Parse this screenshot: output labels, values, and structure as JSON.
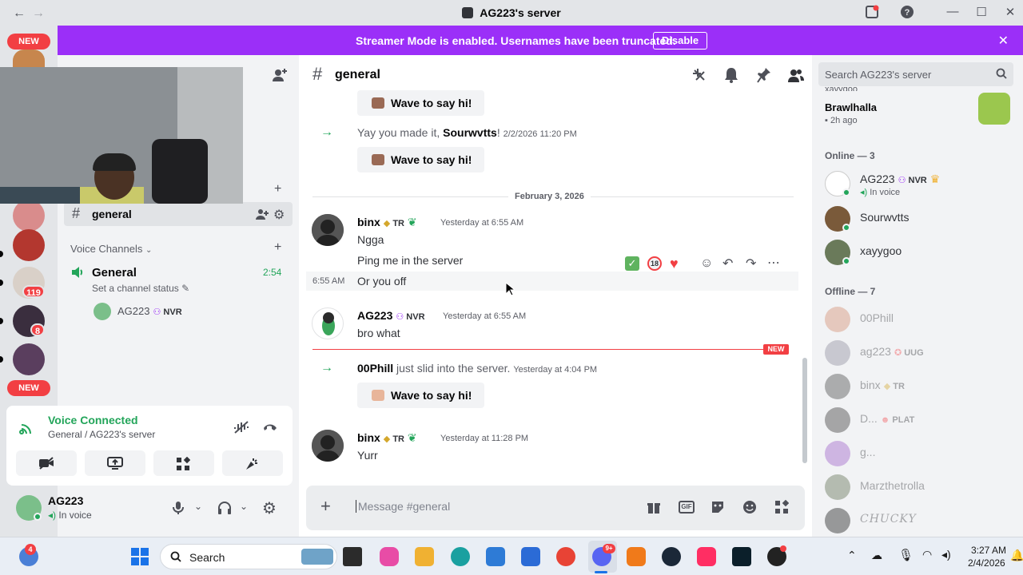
{
  "window": {
    "title": "AG223's server",
    "back": "←",
    "forward": "→"
  },
  "banner": {
    "message": "Streamer Mode is enabled. Usernames have been truncated.",
    "button": "Disable"
  },
  "servers": {
    "new_badge": "NEW",
    "badges": [
      "119",
      "8"
    ]
  },
  "sidebar": {
    "text_channel": "general",
    "voice_header": "Voice Channels",
    "voice_channel": "General",
    "voice_time": "2:54",
    "channel_status": "Set a channel status",
    "voice_user": "AG223",
    "voice_user_tag": "NVR"
  },
  "voice_panel": {
    "title": "Voice Connected",
    "subtitle": "General / AG223's server"
  },
  "user": {
    "name": "AG223",
    "status": "In voice"
  },
  "chat": {
    "channel": "general",
    "date_divider": "February 3, 2026",
    "wave_label": "Wave to say hi!",
    "join1": {
      "text": "Yay you made it, ",
      "name": "Sourwvtts",
      "suffix": "!",
      "time": "2/2/2026 11:20 PM"
    },
    "msg1": {
      "user": "binx",
      "tag": "TR",
      "time": "Yesterday at 6:55 AM",
      "lines": [
        "Ngga",
        "Ping me in the server",
        "Or you off"
      ],
      "hover_time": "6:55 AM"
    },
    "reactions": {
      "count": "18"
    },
    "msg2": {
      "user": "AG223",
      "tag": "NVR",
      "time": "Yesterday at 6:55 AM",
      "text": "bro what"
    },
    "new_label": "NEW",
    "join2": {
      "name": "00Phill",
      "text": " just slid into the server.",
      "time": "Yesterday at 4:04 PM"
    },
    "msg3": {
      "user": "binx",
      "tag": "TR",
      "time": "Yesterday at 11:28 PM",
      "text": "Yurr"
    },
    "composer_placeholder": "Message #general"
  },
  "members": {
    "search_placeholder": "Search AG223's server",
    "activity": {
      "top": "xayygoo",
      "game": "Brawlhalla",
      "ago": "2h ago"
    },
    "online_header": "Online — 3",
    "online": [
      {
        "name": "AG223",
        "tag": "NVR",
        "status": "In voice"
      },
      {
        "name": "Sourwvtts"
      },
      {
        "name": "xayygoo"
      }
    ],
    "offline_header": "Offline — 7",
    "offline": [
      {
        "name": "00Phill",
        "tag": ""
      },
      {
        "name": "ag223",
        "tag": "UUG"
      },
      {
        "name": "binx",
        "tag": "TR"
      },
      {
        "name": "D...",
        "tag": "PLAT"
      },
      {
        "name": "g...",
        "tag": ""
      },
      {
        "name": "Marzthetrolla",
        "tag": ""
      },
      {
        "name": "CHUCKY",
        "tag": ""
      }
    ]
  },
  "taskbar": {
    "search": "Search",
    "time": "3:27 AM",
    "date": "2/4/2026",
    "notify": "4",
    "discord_badge": "9+"
  }
}
